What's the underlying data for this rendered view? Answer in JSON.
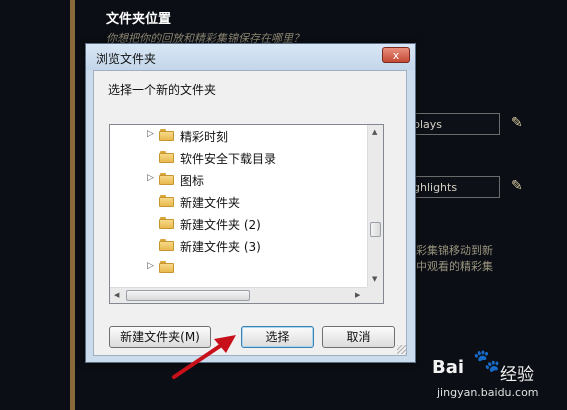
{
  "background": {
    "section_title": "文件夹位置",
    "section_subtitle": "你想把你的回放和精彩集锦保存在哪里？",
    "fields": [
      {
        "value": "plays"
      },
      {
        "value": "ghlights"
      }
    ],
    "description_lines": [
      "彩集锦移动到新",
      "中观看的精彩集"
    ]
  },
  "dialog": {
    "title": "浏览文件夹",
    "close_label": "x",
    "prompt": "选择一个新的文件夹",
    "tree_items": [
      {
        "label": "精彩时刻",
        "expandable": true
      },
      {
        "label": "软件安全下载目录",
        "expandable": false
      },
      {
        "label": "图标",
        "expandable": true
      },
      {
        "label": "新建文件夹",
        "expandable": false
      },
      {
        "label": "新建文件夹 (2)",
        "expandable": false
      },
      {
        "label": "新建文件夹 (3)",
        "expandable": false
      },
      {
        "label": "",
        "expandable": true
      }
    ],
    "buttons": {
      "new_folder": "新建文件夹(M)",
      "select": "选择",
      "cancel": "取消"
    }
  },
  "watermark": {
    "logo": "Bai",
    "paw": "🐾",
    "brand": "经验",
    "url": "jingyan.baidu.com"
  }
}
